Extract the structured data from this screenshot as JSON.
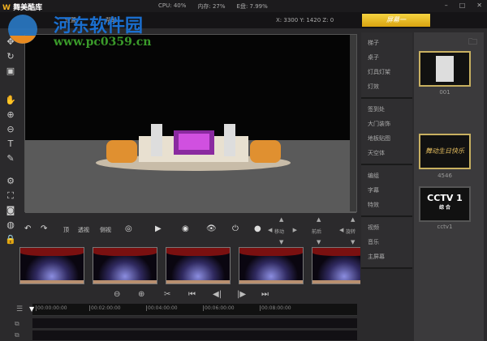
{
  "app": {
    "logo_mark": "W",
    "title": "舞美酷库"
  },
  "stats": {
    "cpu": "CPU: 40%",
    "mem": "内存: 27%",
    "disk": "E盘: 7.99%"
  },
  "window": {
    "minimize": "–",
    "maximize": "□",
    "close": "✕"
  },
  "menu": [
    "设置",
    "帮助"
  ],
  "coords": "X: 3300  Y: 1420  Z: 0",
  "screen_button": "屏幕一",
  "categories": [
    [
      "梯子",
      "桌子",
      "灯具灯架",
      "灯效"
    ],
    [
      "签到处",
      "大门装饰",
      "地板贴图",
      "天空体"
    ],
    [
      "编组",
      "字幕",
      "特效"
    ],
    [
      "视频",
      "音乐",
      "主屏幕"
    ]
  ],
  "thumbnails": [
    {
      "label": "001"
    },
    {
      "label": "4546",
      "art": "舞动生日快乐"
    },
    {
      "label": "cctv1",
      "art": "CCTV 1",
      "sub": "综 合"
    }
  ],
  "controls": {
    "view_top": "顶",
    "view_persp": "透视",
    "view_side": "侧视",
    "dpad_move": "移动",
    "dpad_depth": "前后",
    "dpad_rotate": "旋转"
  },
  "timeline": {
    "ticks": [
      "00:00:00:00",
      "00:02:00:00",
      "00:04:00:00",
      "00:06:00:00",
      "00:08:00:00"
    ]
  },
  "watermark": {
    "name": "河东软件园",
    "url": "www.pc0359.cn"
  }
}
